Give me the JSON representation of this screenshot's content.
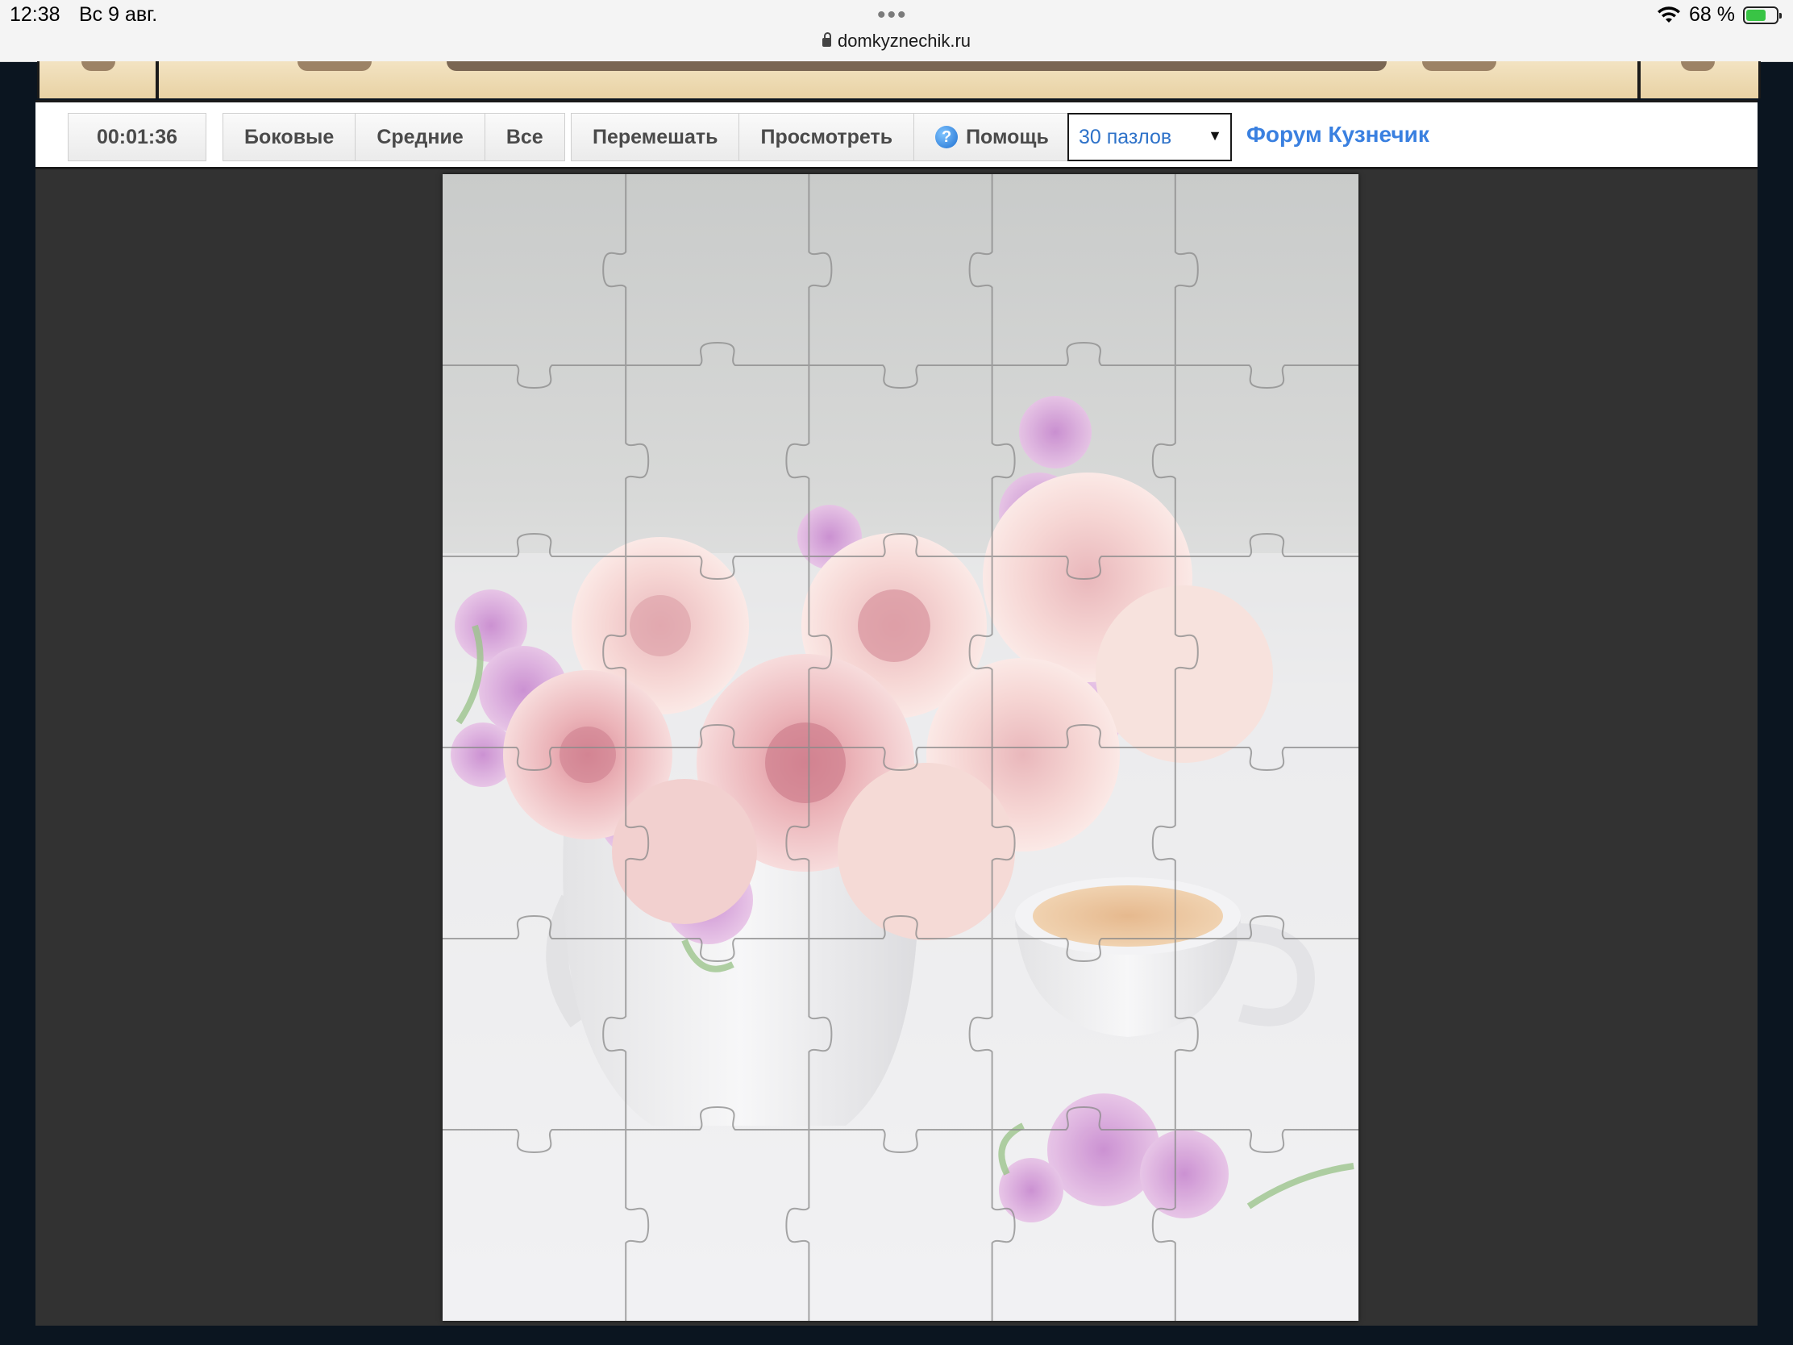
{
  "status_bar": {
    "time": "12:38",
    "date": "Вс 9 авг.",
    "url": "domkyznechik.ru",
    "battery_text": "68 %",
    "battery_level": 0.68,
    "icons": [
      "more-dots-icon",
      "lock-icon",
      "wifi-icon",
      "battery-icon"
    ]
  },
  "toolbar": {
    "timer": "00:01:36",
    "filter_buttons": [
      "Боковые",
      "Средние",
      "Все"
    ],
    "action_buttons": [
      "Перемешать",
      "Просмотреть",
      "Помощь"
    ],
    "help_icon": "?",
    "piece_count": "30 пазлов",
    "forum_link": "Форум Кузнечик"
  },
  "puzzle": {
    "columns": 5,
    "rows": 6,
    "image_subject": "pink roses bouquet in white pitcher with cup of coffee"
  },
  "colors": {
    "play_area": "#323232",
    "link": "#3a80e0",
    "header_deco": "#f3e3c2"
  }
}
